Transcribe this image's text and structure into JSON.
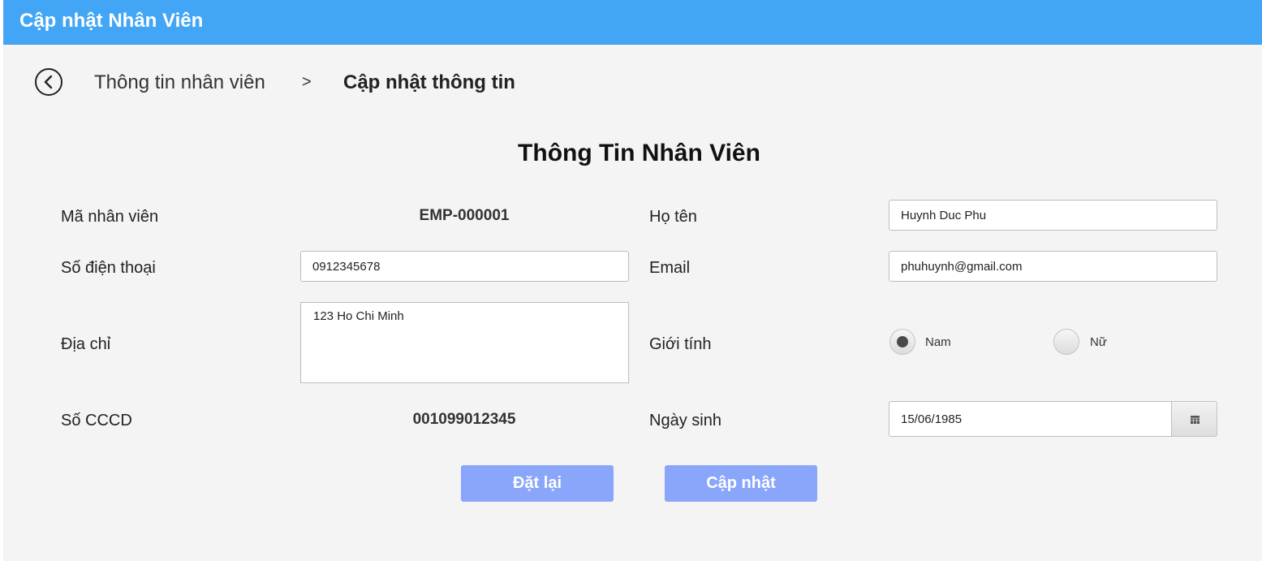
{
  "window": {
    "title": "Cập nhật Nhân Viên",
    "accent_color": "#42a5f5"
  },
  "breadcrumb": {
    "back_icon": "chevron-left-circle-icon",
    "parent": "Thông tin nhân viên",
    "separator": ">",
    "current": "Cập nhật thông tin"
  },
  "form": {
    "title": "Thông Tin Nhân Viên",
    "employee_id_label": "Mã nhân viên",
    "employee_id_value": "EMP-000001",
    "full_name_label": "Họ tên",
    "full_name_value": "Huynh Duc Phu",
    "phone_label": "Số điện thoại",
    "phone_value": "0912345678",
    "email_label": "Email",
    "email_value": "phuhuynh@gmail.com",
    "address_label": "Địa chỉ",
    "address_value": "123 Ho Chi Minh",
    "gender_label": "Giới tính",
    "gender_options": [
      {
        "label": "Nam",
        "selected": true
      },
      {
        "label": "Nữ",
        "selected": false
      }
    ],
    "id_card_label": "Số CCCD",
    "id_card_value": "001099012345",
    "dob_label": "Ngày sinh",
    "dob_value": "15/06/1985",
    "calendar_icon": "calendar-icon"
  },
  "actions": {
    "reset_label": "Đặt lại",
    "update_label": "Cập nhật",
    "button_color": "#8aa6fb"
  }
}
